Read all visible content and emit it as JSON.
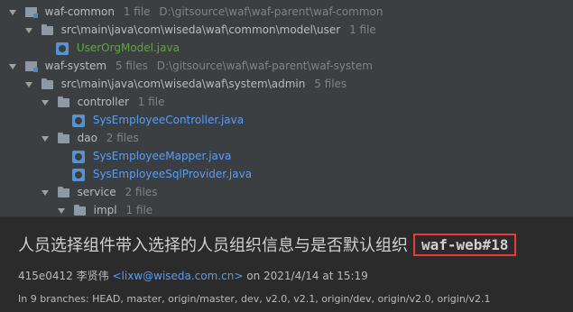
{
  "tree": [
    {
      "kind": "module",
      "name": "waf-common",
      "count": "1 file",
      "path": "D:\\gitsource\\waf\\waf-parent\\waf-common"
    },
    {
      "kind": "folder",
      "name": "src\\main\\java\\com\\wiseda\\waf\\common\\model\\user",
      "count": "1 file"
    },
    {
      "kind": "class",
      "name": "UserOrgModel.java",
      "color": "#62a347"
    },
    {
      "kind": "module",
      "name": "waf-system",
      "count": "5 files",
      "path": "D:\\gitsource\\waf\\waf-parent\\waf-system"
    },
    {
      "kind": "folder",
      "name": "src\\main\\java\\com\\wiseda\\waf\\system\\admin",
      "count": "5 files"
    },
    {
      "kind": "folder",
      "name": "controller",
      "count": "1 file"
    },
    {
      "kind": "class",
      "name": "SysEmployeeController.java",
      "color": "#589df6"
    },
    {
      "kind": "folder",
      "name": "dao",
      "count": "2 files"
    },
    {
      "kind": "class",
      "name": "SysEmployeeMapper.java",
      "color": "#589df6"
    },
    {
      "kind": "class",
      "name": "SysEmployeeSqlProvider.java",
      "color": "#589df6"
    },
    {
      "kind": "folder",
      "name": "service",
      "count": "2 files"
    },
    {
      "kind": "folder",
      "name": "impl",
      "count": "1 file"
    }
  ],
  "commit": {
    "subject": "人员选择组件带入选择的人员组织信息与是否默认组织",
    "ref": "waf-web#18",
    "hash": "415e0412",
    "author": "李贤伟",
    "email": "<lixw@wiseda.com.cn>",
    "date": "on 2021/4/14 at 15:19",
    "branches": "In 9 branches: HEAD, master, origin/master, dev, v2.0, v2.1, origin/dev, origin/v2.0, origin/v2.1"
  }
}
